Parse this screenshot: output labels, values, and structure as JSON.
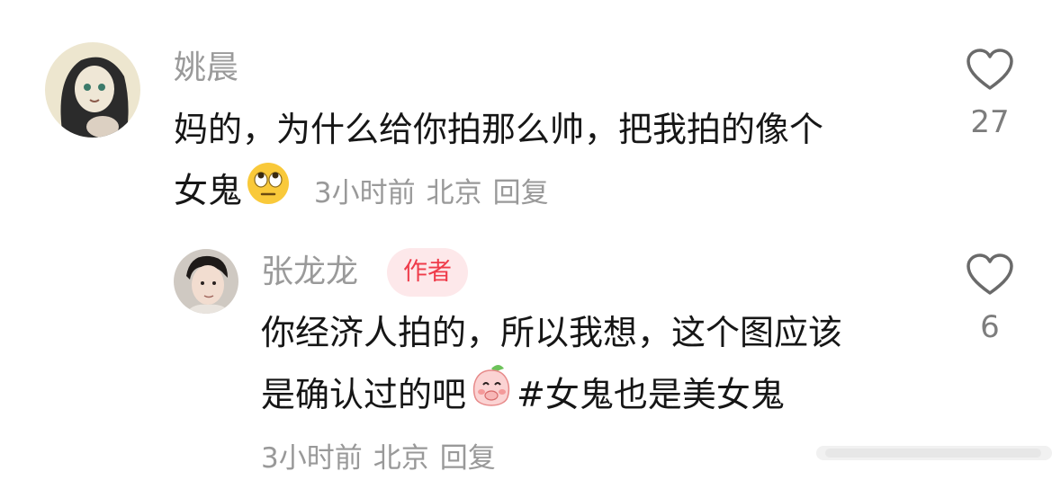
{
  "comments": [
    {
      "username": "姚晨",
      "text_line1": "妈的，为什么给你拍那么帅，把我拍的像个",
      "text_line2": "女鬼",
      "emoji": "eye-roll-emoji",
      "time": "3小时前",
      "location": "北京",
      "reply_label": "回复",
      "likes": "27"
    },
    {
      "username": "张龙龙",
      "badge": "作者",
      "text_line1": "你经济人拍的，所以我想，这个图应该",
      "text_line2_before": "是确认过的吧",
      "emoji": "shy-peach-emoji",
      "text_line2_after": "#女鬼也是美女鬼",
      "time": "3小时前",
      "location": "北京",
      "reply_label": "回复",
      "likes": "6"
    }
  ],
  "icons": {
    "like": "heart-outline-icon"
  },
  "colors": {
    "username": "#9a9a9a",
    "badge_bg": "#fde8ea",
    "badge_text": "#ef3b4a",
    "meta": "#999999"
  }
}
